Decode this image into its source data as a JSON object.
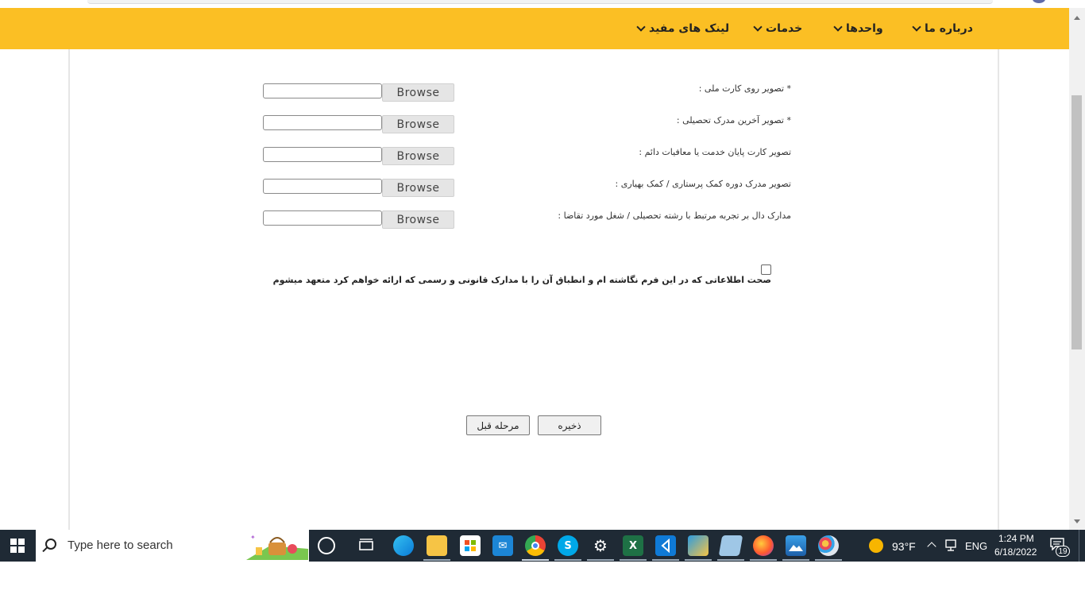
{
  "nav": {
    "items": [
      {
        "label": "درباره ما"
      },
      {
        "label": "واحدها"
      },
      {
        "label": "خدمات"
      },
      {
        "label": "لینک های مفید"
      }
    ]
  },
  "form": {
    "uploads": [
      {
        "label": "* تصویر روی کارت ملی :",
        "button": "Browse"
      },
      {
        "label": "* تصویر آخرین مدرک تحصیلی :",
        "button": "Browse"
      },
      {
        "label": "تصویر کارت پایان خدمت یا معافیات دائم :",
        "button": "Browse"
      },
      {
        "label": "تصویر مدرک دوره کمک پرستاری / کمک بهیاری :",
        "button": "Browse"
      },
      {
        "label": "مدارک دال بر تجربه مرتبط با رشته تحصیلی / شغل مورد تقاضا :",
        "button": "Browse"
      }
    ],
    "agreement": "صحت اطلاعاتی که در این فرم نگاشته ام و انطباق آن را با مدارک قانونی و رسمی که ارائه خواهم کرد متعهد میشوم",
    "save_label": "ذخیره",
    "prev_label": "مرحله قبل"
  },
  "taskbar": {
    "search_placeholder": "Type here to search",
    "apps": [
      "cortana-icon",
      "task-view-icon",
      "edge-icon",
      "file-explorer-icon",
      "store-icon",
      "mail-icon",
      "chrome-icon",
      "skype-icon",
      "settings-icon",
      "excel-icon",
      "vscode-icon",
      "snip-icon",
      "notepad-icon",
      "firefox-icon",
      "photos-icon",
      "paint-icon"
    ],
    "weather": "93°F",
    "language": "ENG",
    "time": "1:24 PM",
    "date": "6/18/2022",
    "notifications": "19"
  },
  "colors": {
    "nav_bg": "#fbbf24",
    "taskbar_bg": "#1f2a35"
  }
}
